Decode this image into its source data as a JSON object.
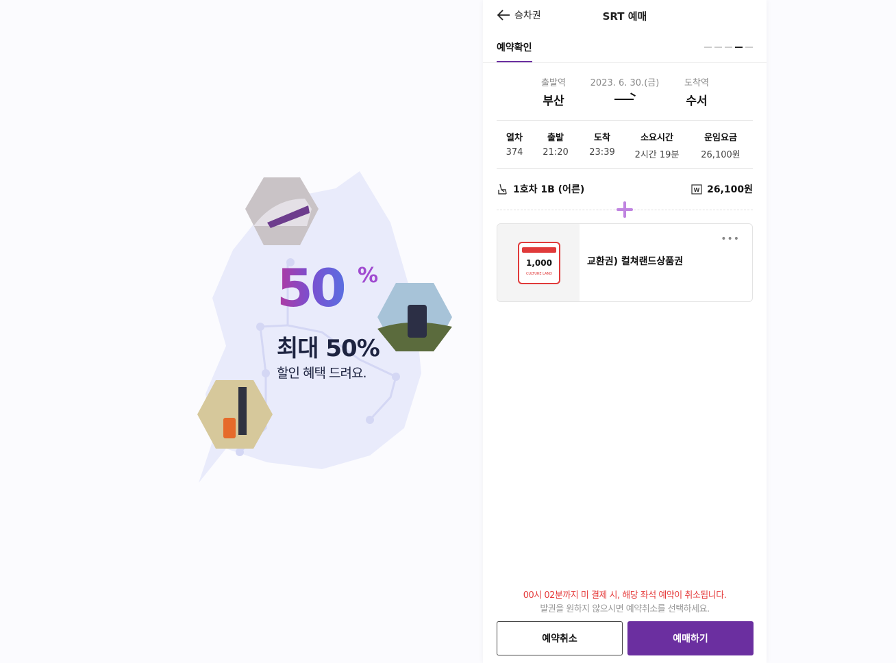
{
  "promo": {
    "fifty_text": "50",
    "percent_sign": "%",
    "headline": "최대 50%",
    "subline": "할인 혜택 드려요."
  },
  "header": {
    "back_label": "승차권",
    "title": "SRT 예매"
  },
  "tabs": {
    "active_label": "예약확인",
    "steps_total": 5,
    "current_step": 4
  },
  "route": {
    "departure_label": "출발역",
    "departure": "부산",
    "date": "2023. 6. 30.(금)",
    "arrival_label": "도착역",
    "arrival": "수서"
  },
  "info": {
    "columns": [
      {
        "header": "열차",
        "value": "374"
      },
      {
        "header": "출발",
        "value": "21:20"
      },
      {
        "header": "도착",
        "value": "23:39"
      },
      {
        "header": "소요시간",
        "value": "2시간 19분"
      },
      {
        "header": "운임요금",
        "value": "26,100원"
      }
    ]
  },
  "seat": {
    "label": "1호차 1B (어른)",
    "price": "26,100원"
  },
  "coupon": {
    "amount": "1,000",
    "brand": "CULTURE LAND",
    "name": "교환권) 컬쳐랜드상품권",
    "more": "•••"
  },
  "notice": {
    "warning": "00시 02분까지 미 결제 시, 해당 좌석 예약이 취소됩니다.",
    "hint": "발권을 원하지 않으시면 예약취소를 선택하세요."
  },
  "buttons": {
    "cancel": "예약취소",
    "buy": "예매하기"
  },
  "colors": {
    "accent": "#6b2fa0",
    "warning": "#e53b3b",
    "plus": "#c084e0"
  }
}
